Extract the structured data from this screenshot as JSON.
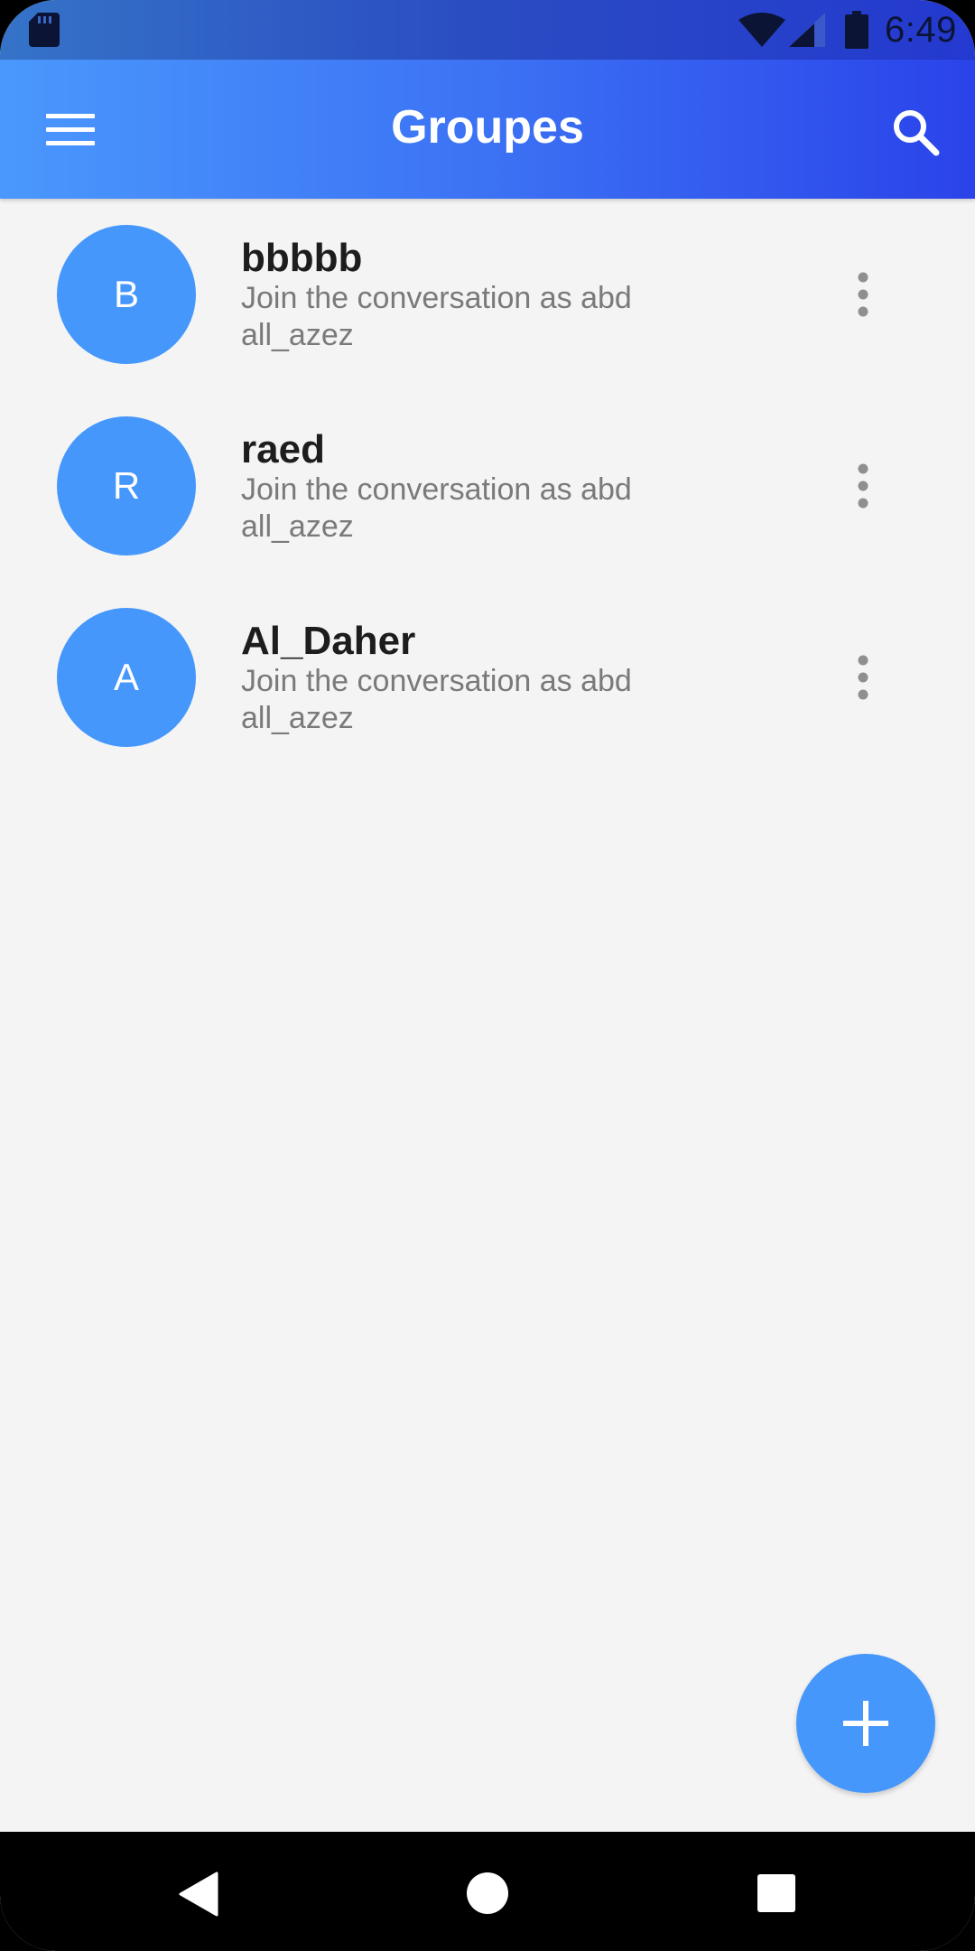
{
  "status_bar": {
    "time": "6:49",
    "icons": [
      "sd-card-icon",
      "wifi-icon",
      "cell-signal-icon",
      "battery-icon"
    ]
  },
  "app_bar": {
    "title": "Groupes",
    "menu_icon": "hamburger-menu-icon",
    "search_icon": "search-icon"
  },
  "groups": [
    {
      "initial": "B",
      "name": "bbbbb",
      "subtitle": "Join the conversation as abd all_azez"
    },
    {
      "initial": "R",
      "name": "raed",
      "subtitle": "Join the conversation as abd all_azez"
    },
    {
      "initial": "A",
      "name": "Al_Daher",
      "subtitle": "Join the conversation as abd all_azez"
    }
  ],
  "fab": {
    "icon": "plus-icon"
  },
  "nav_bar": {
    "icons": [
      "back-icon",
      "home-icon",
      "recents-icon"
    ]
  },
  "colors": {
    "app_bar_start": "#4a98fd",
    "app_bar_end": "#2a43ea",
    "avatar": "#4597fb",
    "fab": "#4597fb",
    "background": "#f4f4f5",
    "title_text": "#1d1d1d",
    "subtitle_text": "#7a7a7a"
  }
}
